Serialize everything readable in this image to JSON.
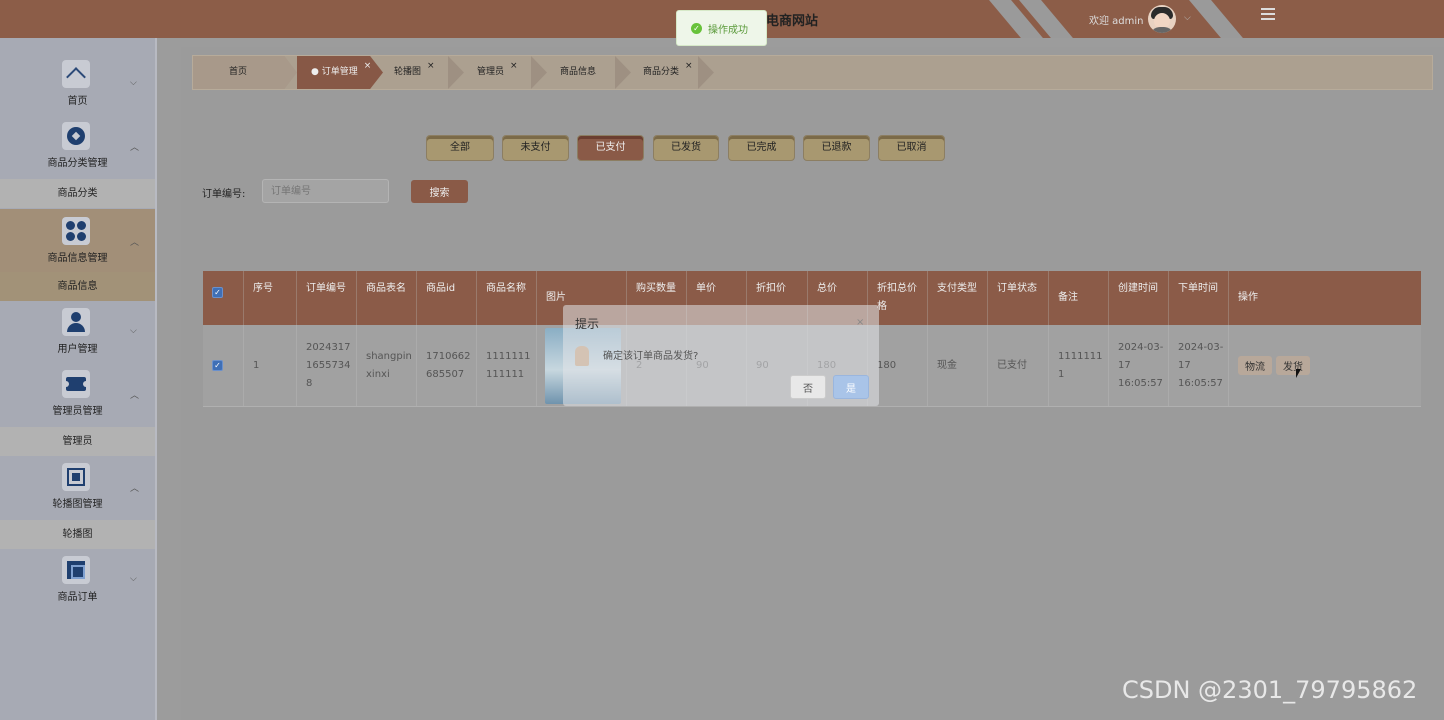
{
  "header": {
    "site_title": "电商网站",
    "welcome": "欢迎 admin",
    "chevron": "⌵"
  },
  "toast": {
    "text": "操作成功",
    "check": "✓"
  },
  "sidebar": {
    "items": [
      {
        "label": "首页",
        "icon": "home-icon",
        "arrow": "⌵"
      },
      {
        "label": "商品分类管理",
        "icon": "category-icon",
        "arrow": "︿",
        "sub": "商品分类"
      },
      {
        "label": "商品信息管理",
        "icon": "grid-icon",
        "arrow": "︿",
        "sub": "商品信息"
      },
      {
        "label": "用户管理",
        "icon": "user-icon",
        "arrow": "⌵"
      },
      {
        "label": "管理员管理",
        "icon": "ticket-icon",
        "arrow": "︿",
        "sub": "管理员"
      },
      {
        "label": "轮播图管理",
        "icon": "chip-icon",
        "arrow": "︿",
        "sub": "轮播图"
      },
      {
        "label": "商品订单",
        "icon": "frame-icon",
        "arrow": "⌵"
      }
    ]
  },
  "breadcrumb": {
    "items": [
      "首页",
      "● 订单管理",
      "轮播图",
      "管理员",
      "商品信息",
      "商品分类"
    ],
    "close": "×"
  },
  "status_tabs": [
    "全部",
    "未支付",
    "已支付",
    "已发货",
    "已完成",
    "已退款",
    "已取消"
  ],
  "search": {
    "label": "订单编号:",
    "placeholder": "订单编号",
    "button": "搜索"
  },
  "table": {
    "check": "✓",
    "headers": [
      "序号",
      "订单编号",
      "商品表名",
      "商品id",
      "商品名称",
      "图片",
      "购买数量",
      "单价",
      "折扣价",
      "总价",
      "折扣总价格",
      "支付类型",
      "订单状态",
      "备注",
      "创建时间",
      "下单时间",
      "操作"
    ],
    "row": {
      "index": "1",
      "order_no": "20243171655734 8",
      "table_name": "shangpinxinxi",
      "goods_id": "1710662685507",
      "goods_name": "1111111111111",
      "quantity": "2",
      "price": "90",
      "discount_price": "90",
      "total": "180",
      "discount_total": "180",
      "pay_type": "现金",
      "status": "已支付",
      "remark": "11111111",
      "created": "2024-03-17 16:05:57",
      "ordered": "2024-03-17 16:05:57",
      "actions": [
        "物流",
        "发货"
      ]
    }
  },
  "dialog": {
    "title": "提示",
    "close": "×",
    "message": "确定该订单商品发货?",
    "cancel": "否",
    "confirm": "是"
  },
  "watermark": "CSDN @2301_79795862"
}
